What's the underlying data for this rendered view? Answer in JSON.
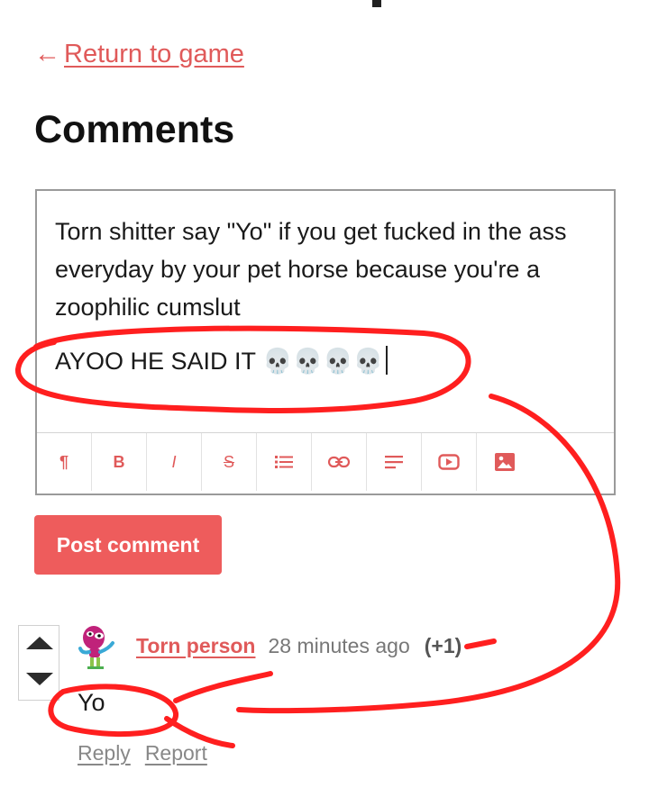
{
  "nav": {
    "back_label": "Return to game",
    "back_arrow": "←"
  },
  "page": {
    "title": "Comments"
  },
  "editor": {
    "line1": "Torn shitter say \"Yo\" if you get fucked in the ass everyday by your pet horse because you're a zoophilic cumslut",
    "line2": "AYOO HE SAID IT",
    "line2_emojis": "💀💀💀💀",
    "toolbar": [
      {
        "name": "paragraph",
        "glyph": "¶"
      },
      {
        "name": "bold",
        "glyph": "B"
      },
      {
        "name": "italic",
        "glyph": "I"
      },
      {
        "name": "strikethrough",
        "glyph": "S"
      },
      {
        "name": "list",
        "glyph": "list-icon"
      },
      {
        "name": "link",
        "glyph": "link-icon"
      },
      {
        "name": "align",
        "glyph": "align-icon"
      },
      {
        "name": "video",
        "glyph": "video-icon"
      },
      {
        "name": "image",
        "glyph": "image-icon"
      }
    ]
  },
  "post_button": {
    "label": "Post comment"
  },
  "comment": {
    "author": "Torn person",
    "time": "28 minutes ago",
    "score": "(+1)",
    "body": "Yo",
    "reply_label": "Reply",
    "report_label": "Report"
  },
  "colors": {
    "accent": "#e05a5a",
    "button": "#ee5c5c",
    "annotation": "#ff1f1f"
  }
}
